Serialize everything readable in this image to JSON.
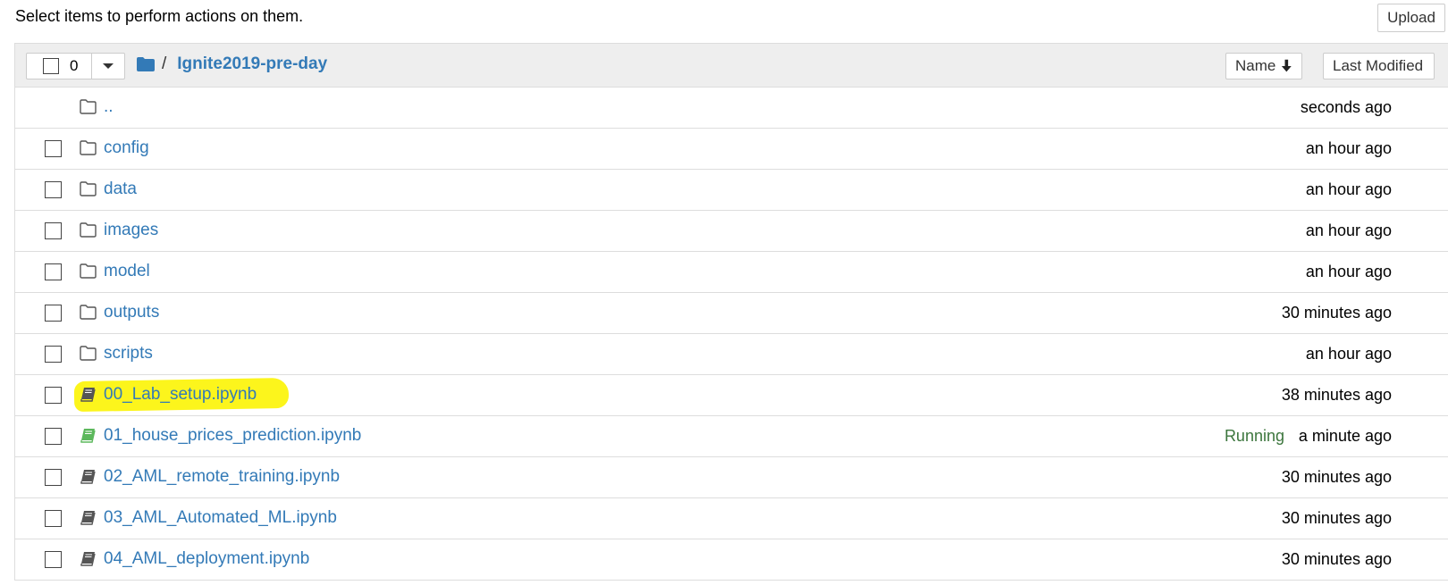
{
  "instructions": "Select items to perform actions on them.",
  "toolbar": {
    "upload_label": "Upload"
  },
  "header": {
    "selected_count": "0",
    "breadcrumb_separator": "/",
    "breadcrumb_current": "Ignite2019-pre-day",
    "sort_name_label": "Name",
    "sort_modified_label": "Last Modified"
  },
  "rows": [
    {
      "name": "..",
      "type": "parent",
      "time": "seconds ago",
      "status": ""
    },
    {
      "name": "config",
      "type": "folder",
      "time": "an hour ago",
      "status": ""
    },
    {
      "name": "data",
      "type": "folder",
      "time": "an hour ago",
      "status": ""
    },
    {
      "name": "images",
      "type": "folder",
      "time": "an hour ago",
      "status": ""
    },
    {
      "name": "model",
      "type": "folder",
      "time": "an hour ago",
      "status": ""
    },
    {
      "name": "outputs",
      "type": "folder",
      "time": "30 minutes ago",
      "status": ""
    },
    {
      "name": "scripts",
      "type": "folder",
      "time": "an hour ago",
      "status": ""
    },
    {
      "name": "00_Lab_setup.ipynb",
      "type": "notebook",
      "time": "38 minutes ago",
      "status": "",
      "highlighted": true
    },
    {
      "name": "01_house_prices_prediction.ipynb",
      "type": "notebook-running",
      "time": "a minute ago",
      "status": "Running"
    },
    {
      "name": "02_AML_remote_training.ipynb",
      "type": "notebook",
      "time": "30 minutes ago",
      "status": ""
    },
    {
      "name": "03_AML_Automated_ML.ipynb",
      "type": "notebook",
      "time": "30 minutes ago",
      "status": ""
    },
    {
      "name": "04_AML_deployment.ipynb",
      "type": "notebook",
      "time": "30 minutes ago",
      "status": ""
    }
  ],
  "colors": {
    "link": "#337ab7",
    "running": "#3c763d",
    "notebook_running_icon": "#5cb85c",
    "notebook_icon": "#555555",
    "highlight": "#ffff2a"
  },
  "icons": {
    "folder": "folder-outline-icon",
    "notebook": "book-icon",
    "breadcrumb_folder": "folder-solid-icon",
    "sort": "arrow-down-icon",
    "dropdown": "caret-down-icon"
  }
}
